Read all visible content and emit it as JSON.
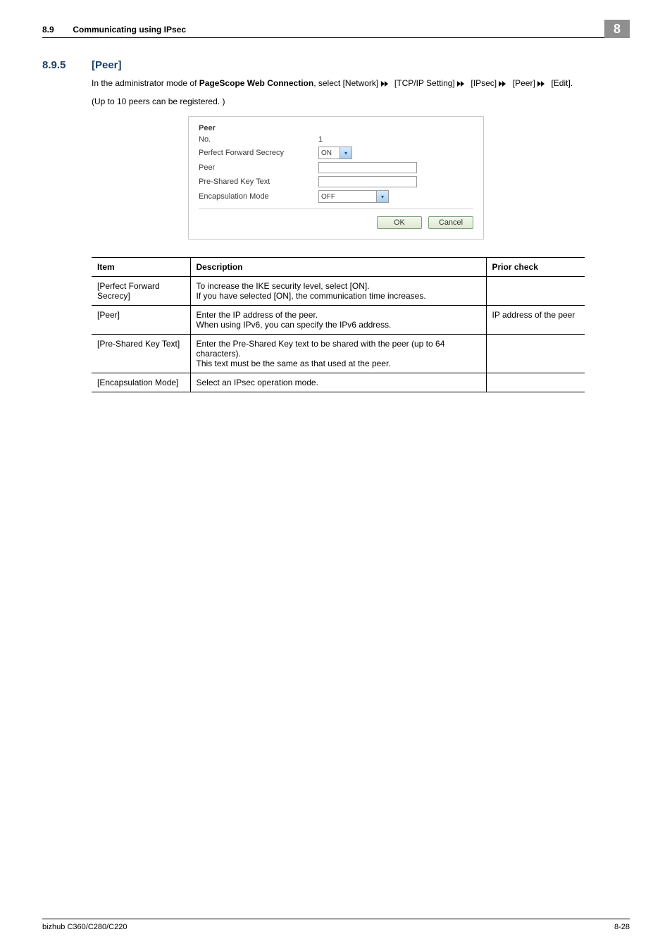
{
  "header": {
    "section_no": "8.9",
    "section_title": "Communicating using IPsec",
    "chapter": "8"
  },
  "section": {
    "num": "8.9.5",
    "title": "[Peer]"
  },
  "intro": {
    "p1_a": "In the administrator mode of ",
    "p1_bold": "PageScope Web Connection",
    "p1_b": ", select [Network] ",
    "p1_c": " [TCP/IP Setting] ",
    "p1_d": " [IPsec] ",
    "p1_e": " [Peer] ",
    "p1_f": " [Edit].",
    "p2": "(Up to 10 peers can be registered. )"
  },
  "ui": {
    "title": "Peer",
    "rows": {
      "no_label": "No.",
      "no_value": "1",
      "pfs_label": "Perfect Forward Secrecy",
      "pfs_value": "ON",
      "peer_label": "Peer",
      "psk_label": "Pre-Shared Key Text",
      "encap_label": "Encapsulation Mode",
      "encap_value": "OFF"
    },
    "buttons": {
      "ok": "OK",
      "cancel": "Cancel"
    }
  },
  "table": {
    "headers": {
      "item": "Item",
      "desc": "Description",
      "prior": "Prior check"
    },
    "rows": [
      {
        "item": "[Perfect Forward Secrecy]",
        "desc": "To increase the IKE security level, select [ON].\nIf you have selected [ON], the communication time increases.",
        "prior": ""
      },
      {
        "item": "[Peer]",
        "desc": "Enter the IP address of the peer.\nWhen using IPv6, you can specify the IPv6 address.",
        "prior": "IP address of the peer"
      },
      {
        "item": "[Pre-Shared Key Text]",
        "desc": "Enter the Pre-Shared Key text to be shared with the peer (up to 64 characters).\nThis text must be the same as that used at the peer.",
        "prior": ""
      },
      {
        "item": "[Encapsulation Mode]",
        "desc": "Select an IPsec operation mode.",
        "prior": ""
      }
    ]
  },
  "footer": {
    "left": "bizhub C360/C280/C220",
    "right": "8-28"
  }
}
